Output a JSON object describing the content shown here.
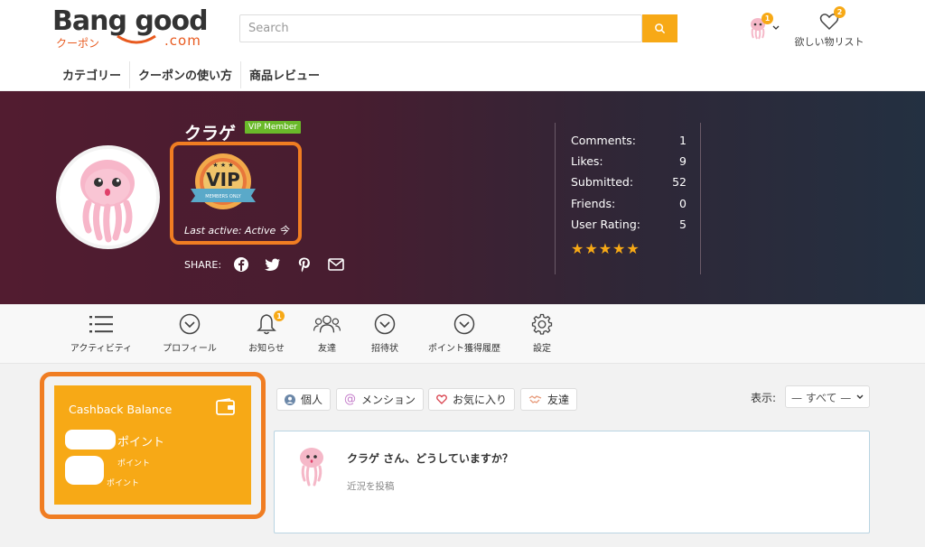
{
  "header": {
    "logo_text": "Bang good",
    "logo_coupon": "クーポン",
    "logo_com": ".com",
    "search_placeholder": "Search",
    "user_badge": "1",
    "wishlist_badge": "2",
    "wishlist_label": "欲しい物リスト"
  },
  "nav": {
    "items": [
      "カテゴリー",
      "クーポンの使い方",
      "商品レビュー"
    ]
  },
  "profile": {
    "name": "クラゲ",
    "vip_tag": "VIP Member",
    "badge_text": "VIP",
    "badge_subtext": "MEMBERS ONLY",
    "last_active": "Last active: Active 今",
    "share_label": "SHARE:"
  },
  "stats": {
    "rows": [
      {
        "label": "Comments:",
        "value": "1"
      },
      {
        "label": "Likes:",
        "value": "9"
      },
      {
        "label": "Submitted:",
        "value": "52"
      },
      {
        "label": "Friends:",
        "value": "0"
      },
      {
        "label": "User Rating:",
        "value": "5"
      }
    ],
    "stars": "★★★★★"
  },
  "tabs": {
    "items": [
      {
        "label": "アクティビティ",
        "icon": "list-icon"
      },
      {
        "label": "プロフィール",
        "icon": "chevron-circle-icon"
      },
      {
        "label": "お知らせ",
        "icon": "bell-icon"
      },
      {
        "label": "友達",
        "icon": "users-icon"
      },
      {
        "label": "招待状",
        "icon": "chevron-circle-icon"
      },
      {
        "label": "ポイント獲得履歴",
        "icon": "chevron-circle-icon"
      },
      {
        "label": "設定",
        "icon": "gear-icon"
      }
    ],
    "notification_badge": "1"
  },
  "cashback": {
    "title": "Cashback Balance",
    "points_label": "ポイント",
    "sub_label_1": "ポイント",
    "sub_label_2": "ポイント"
  },
  "filters": {
    "items": [
      {
        "label": "個人",
        "icon": "user-icon"
      },
      {
        "label": "メンション",
        "icon": "at-icon"
      },
      {
        "label": "お気に入り",
        "icon": "heart-icon"
      },
      {
        "label": "友達",
        "icon": "handshake-icon"
      }
    ],
    "show_label": "表示:",
    "show_value": "— すべて —"
  },
  "post": {
    "question": "クラゲ さん、どうしていますか？",
    "placeholder": "近況を投稿"
  },
  "colors": {
    "accent": "#f7a916",
    "highlight": "#f07d22",
    "vip_green": "#6ab92a"
  }
}
